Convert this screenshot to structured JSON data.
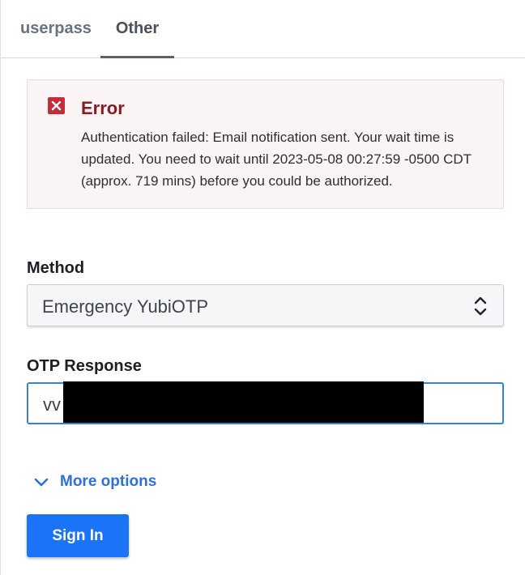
{
  "tabs": [
    {
      "label": "userpass",
      "active": false
    },
    {
      "label": "Other",
      "active": true
    }
  ],
  "error": {
    "title": "Error",
    "message": "Authentication failed: Email notification sent. Your wait time is updated. You need to wait until 2023-05-08 00:27:59 -0500 CDT (approx. 719 mins) before you could be authorized.",
    "icon": "error-x-icon",
    "color": "#c42d3a"
  },
  "method": {
    "label": "Method",
    "selected": "Emergency YubiOTP",
    "icon": "chevron-up-down-icon"
  },
  "otp": {
    "label": "OTP Response",
    "value": "vv"
  },
  "more_options": {
    "label": "More options",
    "icon": "chevron-down-icon",
    "color": "#2f6fd8"
  },
  "sign_in": {
    "label": "Sign In",
    "color": "#1b73f8"
  }
}
